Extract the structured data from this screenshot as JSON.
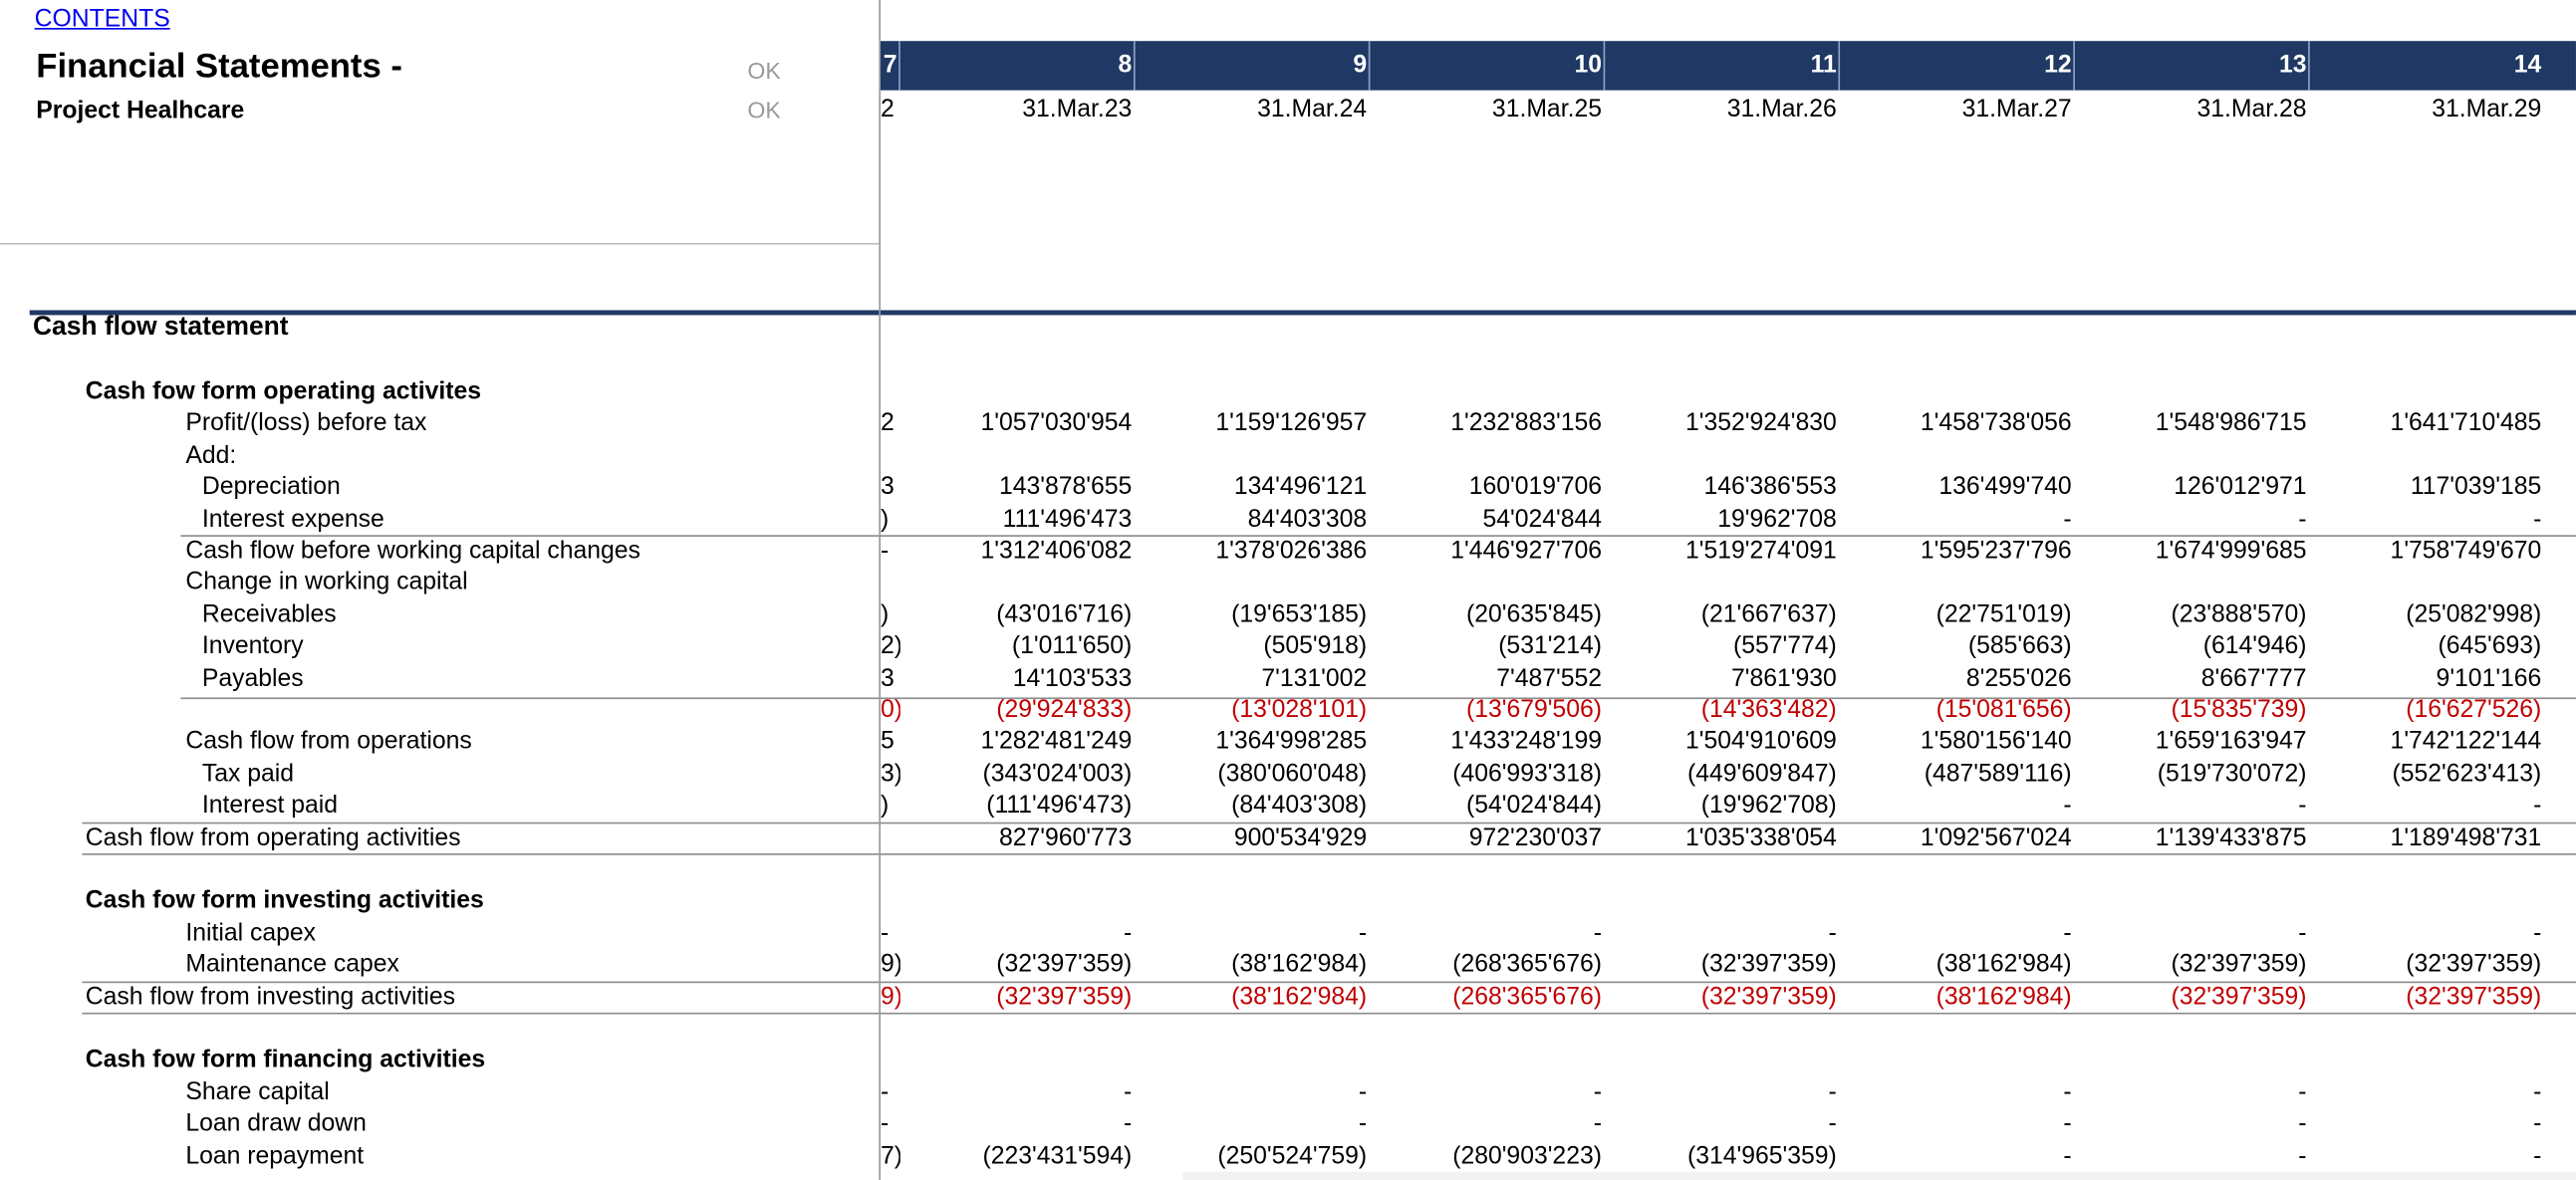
{
  "sheet": {
    "contents_link": "CONTENTS",
    "title": "Financial Statements -",
    "subtitle": "Project Healhcare",
    "ok_flags": [
      "OK",
      "OK"
    ]
  },
  "columns": {
    "partial_header": "7",
    "partial_date": "2",
    "headers": [
      "8",
      "9",
      "10",
      "11",
      "12",
      "13",
      "14"
    ],
    "dates": [
      "31.Mar.23",
      "31.Mar.24",
      "31.Mar.25",
      "31.Mar.26",
      "31.Mar.27",
      "31.Mar.28",
      "31.Mar.29"
    ]
  },
  "section_title": "Cash flow statement",
  "colors": {
    "header_bg": "#1f3864",
    "negative_red": "#c00000",
    "link_blue": "#0000EE"
  },
  "rows": [
    {
      "label": "Cash fow form operating activites",
      "indent": 1,
      "bold": true,
      "values": []
    },
    {
      "label": "Profit/(loss) before tax",
      "indent": 2,
      "edge": "2",
      "values": [
        "1'057'030'954",
        "1'159'126'957",
        "1'232'883'156",
        "1'352'924'830",
        "1'458'738'056",
        "1'548'986'715",
        "1'641'710'485"
      ]
    },
    {
      "label": "Add:",
      "indent": 2,
      "values": []
    },
    {
      "label": "Depreciation",
      "indent": 3,
      "edge": "3",
      "values": [
        "143'878'655",
        "134'496'121",
        "160'019'706",
        "146'386'553",
        "136'499'740",
        "126'012'971",
        "117'039'185"
      ]
    },
    {
      "label": "Interest expense",
      "indent": 3,
      "edge": ")",
      "values": [
        "111'496'473",
        "84'403'308",
        "54'024'844",
        "19'962'708",
        "-",
        "-",
        "-"
      ]
    },
    {
      "label": "Cash flow before working capital changes",
      "indent": 2,
      "edge": "-",
      "values": [
        "1'312'406'082",
        "1'378'026'386",
        "1'446'927'706",
        "1'519'274'091",
        "1'595'237'796",
        "1'674'999'685",
        "1'758'749'670"
      ]
    },
    {
      "label": "Change in working capital",
      "indent": 2,
      "values": []
    },
    {
      "label": "Receivables",
      "indent": 3,
      "edge": ")",
      "values": [
        "(43'016'716)",
        "(19'653'185)",
        "(20'635'845)",
        "(21'667'637)",
        "(22'751'019)",
        "(23'888'570)",
        "(25'082'998)"
      ]
    },
    {
      "label": "Inventory",
      "indent": 3,
      "edge": "2)",
      "values": [
        "(1'011'650)",
        "(505'918)",
        "(531'214)",
        "(557'774)",
        "(585'663)",
        "(614'946)",
        "(645'693)"
      ]
    },
    {
      "label": "Payables",
      "indent": 3,
      "edge": "3",
      "values": [
        "14'103'533",
        "7'131'002",
        "7'487'552",
        "7'861'930",
        "8'255'026",
        "8'667'777",
        "9'101'166"
      ]
    },
    {
      "label": "",
      "indent": 2,
      "edge": "0)",
      "red": true,
      "values": [
        "(29'924'833)",
        "(13'028'101)",
        "(13'679'506)",
        "(14'363'482)",
        "(15'081'656)",
        "(15'835'739)",
        "(16'627'526)"
      ]
    },
    {
      "label": "Cash flow from operations",
      "indent": 2,
      "edge": "5",
      "values": [
        "1'282'481'249",
        "1'364'998'285",
        "1'433'248'199",
        "1'504'910'609",
        "1'580'156'140",
        "1'659'163'947",
        "1'742'122'144"
      ]
    },
    {
      "label": "Tax paid",
      "indent": 3,
      "edge": "3)",
      "values": [
        "(343'024'003)",
        "(380'060'048)",
        "(406'993'318)",
        "(449'609'847)",
        "(487'589'116)",
        "(519'730'072)",
        "(552'623'413)"
      ]
    },
    {
      "label": "Interest paid",
      "indent": 3,
      "edge": ")",
      "values": [
        "(111'496'473)",
        "(84'403'308)",
        "(54'024'844)",
        "(19'962'708)",
        "-",
        "-",
        "-"
      ]
    },
    {
      "label": "Cash flow from operating activities",
      "indent": 1,
      "values": [
        "827'960'773",
        "900'534'929",
        "972'230'037",
        "1'035'338'054",
        "1'092'567'024",
        "1'139'433'875",
        "1'189'498'731"
      ]
    },
    {
      "label": "",
      "indent": 1,
      "values": []
    },
    {
      "label": "Cash fow form investing activities",
      "indent": 1,
      "bold": true,
      "values": []
    },
    {
      "label": "Initial capex",
      "indent": 2,
      "edge": "-",
      "values": [
        "-",
        "-",
        "-",
        "-",
        "-",
        "-",
        "-"
      ]
    },
    {
      "label": "Maintenance capex",
      "indent": 2,
      "edge": "9)",
      "values": [
        "(32'397'359)",
        "(38'162'984)",
        "(268'365'676)",
        "(32'397'359)",
        "(38'162'984)",
        "(32'397'359)",
        "(32'397'359)"
      ]
    },
    {
      "label": "Cash flow from investing activities",
      "indent": 1,
      "edge": "9)",
      "red": true,
      "values": [
        "(32'397'359)",
        "(38'162'984)",
        "(268'365'676)",
        "(32'397'359)",
        "(38'162'984)",
        "(32'397'359)",
        "(32'397'359)"
      ]
    },
    {
      "label": "",
      "indent": 1,
      "values": []
    },
    {
      "label": "Cash fow form financing activities",
      "indent": 1,
      "bold": true,
      "values": []
    },
    {
      "label": "Share capital",
      "indent": 2,
      "edge": "-",
      "values": [
        "-",
        "-",
        "-",
        "-",
        "-",
        "-",
        "-"
      ]
    },
    {
      "label": "Loan draw down",
      "indent": 2,
      "edge": "-",
      "values": [
        "-",
        "-",
        "-",
        "-",
        "-",
        "-",
        "-"
      ]
    },
    {
      "label": "Loan repayment",
      "indent": 2,
      "edge": "7)",
      "values": [
        "(223'431'594)",
        "(250'524'759)",
        "(280'903'223)",
        "(314'965'359)",
        "-",
        "-",
        "-"
      ]
    }
  ]
}
